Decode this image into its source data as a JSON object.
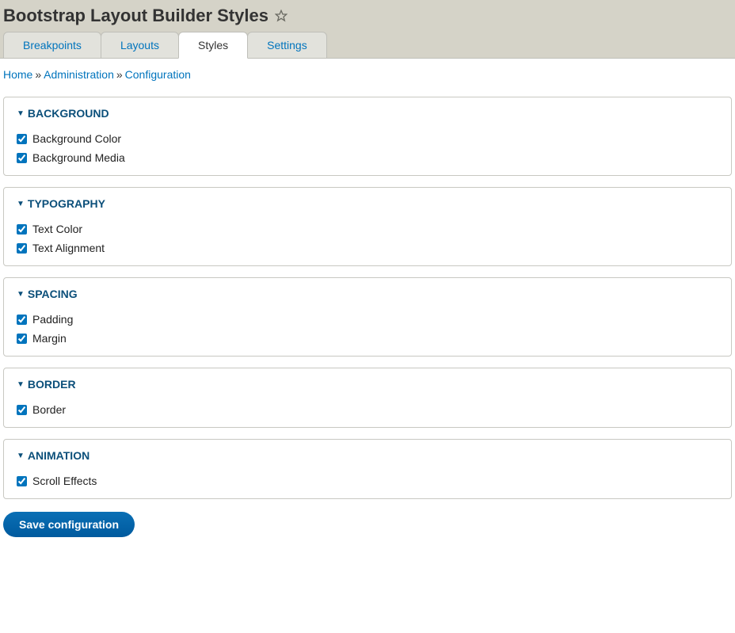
{
  "header": {
    "title": "Bootstrap Layout Builder Styles"
  },
  "tabs": [
    {
      "label": "Breakpoints",
      "active": false
    },
    {
      "label": "Layouts",
      "active": false
    },
    {
      "label": "Styles",
      "active": true
    },
    {
      "label": "Settings",
      "active": false
    }
  ],
  "breadcrumb": {
    "items": [
      {
        "label": "Home"
      },
      {
        "label": "Administration"
      },
      {
        "label": "Configuration"
      }
    ],
    "separator": "»"
  },
  "groups": [
    {
      "name": "background",
      "legend": "Background",
      "items": [
        {
          "label": "Background Color",
          "checked": true
        },
        {
          "label": "Background Media",
          "checked": true
        }
      ]
    },
    {
      "name": "typography",
      "legend": "Typography",
      "items": [
        {
          "label": "Text Color",
          "checked": true
        },
        {
          "label": "Text Alignment",
          "checked": true
        }
      ]
    },
    {
      "name": "spacing",
      "legend": "Spacing",
      "items": [
        {
          "label": "Padding",
          "checked": true
        },
        {
          "label": "Margin",
          "checked": true
        }
      ]
    },
    {
      "name": "border",
      "legend": "Border",
      "items": [
        {
          "label": "Border",
          "checked": true
        }
      ]
    },
    {
      "name": "animation",
      "legend": "Animation",
      "items": [
        {
          "label": "Scroll Effects",
          "checked": true
        }
      ]
    }
  ],
  "actions": {
    "submit_label": "Save configuration"
  }
}
